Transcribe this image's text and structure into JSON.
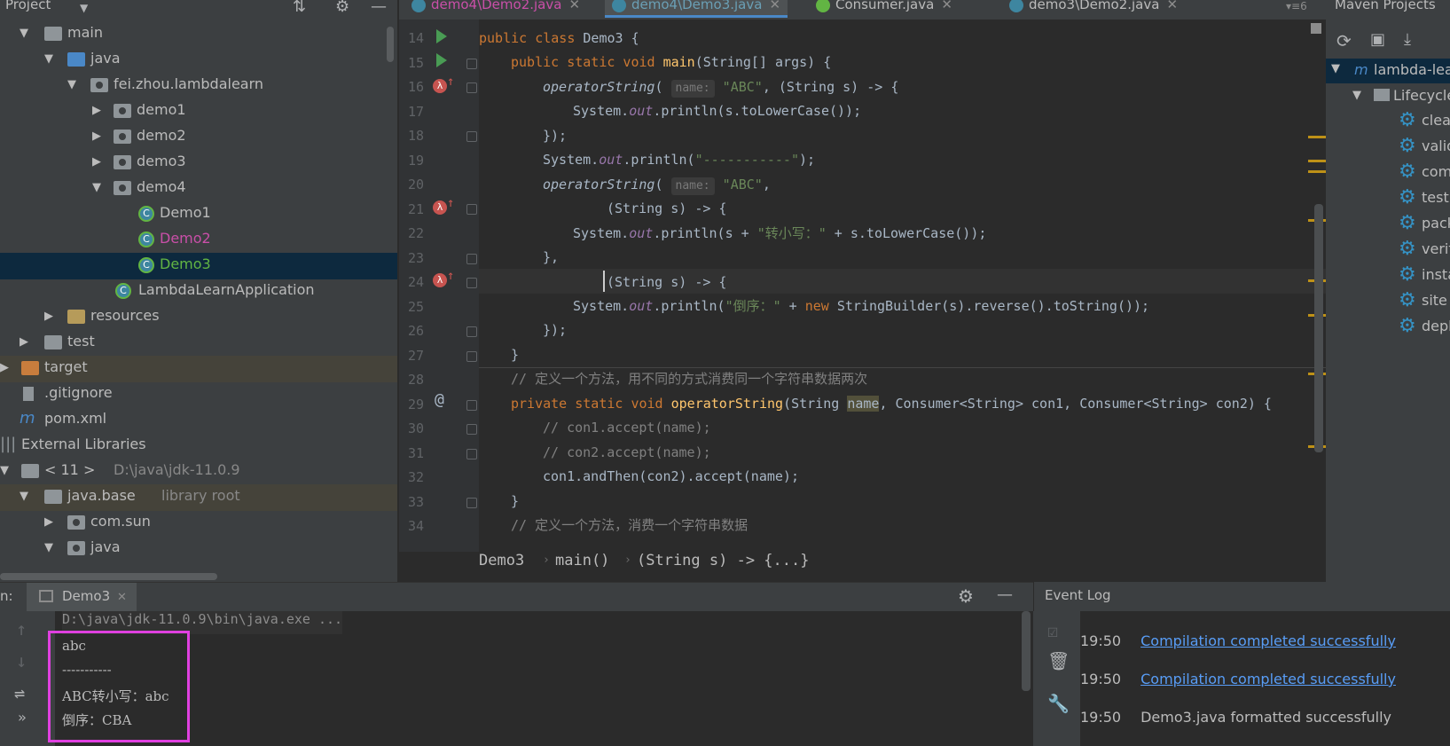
{
  "project_panel": {
    "title": "Project",
    "tree": [
      {
        "label": "main"
      },
      {
        "label": "java"
      },
      {
        "label": "fei.zhou.lambdalearn"
      },
      {
        "label": "demo1"
      },
      {
        "label": "demo2"
      },
      {
        "label": "demo3"
      },
      {
        "label": "demo4"
      },
      {
        "label": "Demo1"
      },
      {
        "label": "Demo2"
      },
      {
        "label": "Demo3"
      },
      {
        "label": "LambdaLearnApplication"
      },
      {
        "label": "resources"
      },
      {
        "label": "test"
      },
      {
        "label": "target"
      },
      {
        "label": ".gitignore"
      },
      {
        "label": "pom.xml"
      },
      {
        "label": "External Libraries"
      },
      {
        "label": "< 11 >",
        "detail": "D:\\java\\jdk-11.0.9"
      },
      {
        "label": "java.base",
        "detail": "library root"
      },
      {
        "label": "com.sun"
      },
      {
        "label": "java"
      }
    ]
  },
  "tabs": [
    {
      "label": "demo4\\Demo2.java",
      "color": "#c679dd"
    },
    {
      "label": "demo4\\Demo3.java",
      "color": "#6a9fb5"
    },
    {
      "label": "Consumer.java",
      "color": "#bbbbbb"
    },
    {
      "label": "demo3\\Demo2.java",
      "color": "#bbbbbb"
    }
  ],
  "tabs_overflow": "6",
  "editor": {
    "line_numbers": [
      "14",
      "15",
      "16",
      "17",
      "18",
      "19",
      "20",
      "21",
      "22",
      "23",
      "24",
      "25",
      "26",
      "27",
      "28",
      "29",
      "30",
      "31",
      "32",
      "33",
      "34"
    ],
    "hint_name": "name:",
    "code": {
      "l14_kw": "public class ",
      "l14_rest": "Demo3 {",
      "l15_kw": "public static void ",
      "l15_fn": "main",
      "l15_rest": "(String[] args) {",
      "l16_fn": "operatorString",
      "l16_open": "(",
      "l16_str": "\"ABC\"",
      "l16_rest": ", (String s) -> {",
      "l17_a": "System.",
      "l17_fld": "out",
      "l17_b": ".println(s.toLowerCase());",
      "l18": "});",
      "l19_a": "System.",
      "l19_fld": "out",
      "l19_b": ".println(",
      "l19_str": "\"-----------\"",
      "l19_c": ");",
      "l20_fn": "operatorString",
      "l20_open": "(",
      "l20_str": "\"ABC\"",
      "l20_rest": ",",
      "l21": "(String s) -> {",
      "l22_a": "System.",
      "l22_fld": "out",
      "l22_b": ".println(s + ",
      "l22_str": "\"转小写：\"",
      "l22_c": " + s.toLowerCase());",
      "l23": "},",
      "l24": "(String s) -> {",
      "l25_a": "System.",
      "l25_fld": "out",
      "l25_b": ".println(",
      "l25_str": "\"倒序：\"",
      "l25_c": " + ",
      "l25_kw": "new ",
      "l25_d": "StringBuilder(s).reverse().toString());",
      "l26": "});",
      "l27": "}",
      "l28": "// 定义一个方法，用不同的方式消费同一个字符串数据两次",
      "l29_kw": "private static void ",
      "l29_fn": "operatorString",
      "l29_a": "(String ",
      "l29_name": "name",
      "l29_b": ", Consumer<String> con1, Consumer<String> con2) {",
      "l30": "// con1.accept(name);",
      "l31": "// con2.accept(name);",
      "l32": "con1.andThen(con2).accept(name);",
      "l33": "}",
      "l34": "// 定义一个方法，消费一个字符串数据"
    }
  },
  "breadcrumb": [
    "Demo3",
    "main()",
    "(String s) -> {...}"
  ],
  "maven": {
    "title": "Maven Projects",
    "root": "lambda-learn",
    "lifecycle": "Lifecycle",
    "goals": [
      "clean",
      "validate",
      "compile",
      "test",
      "package",
      "verify",
      "install",
      "site",
      "deploy"
    ]
  },
  "run": {
    "label": "n:",
    "tab": "Demo3",
    "console": [
      "D:\\java\\jdk-11.0.9\\bin\\java.exe ...",
      "abc",
      "-----------",
      "ABC转小写：abc",
      "倒序：CBA"
    ]
  },
  "event_log": {
    "title": "Event Log",
    "entries": [
      {
        "time": "19:50",
        "text": "Compilation completed successfully",
        "link": true
      },
      {
        "time": "19:50",
        "text": "Compilation completed successfully",
        "link": true
      },
      {
        "time": "19:50",
        "text": "Demo3.java formatted successfully",
        "link": false
      }
    ]
  },
  "colors": {
    "accent": "#4a88c7",
    "highlight_box": "#e040e0",
    "selection": "#0d293e"
  }
}
